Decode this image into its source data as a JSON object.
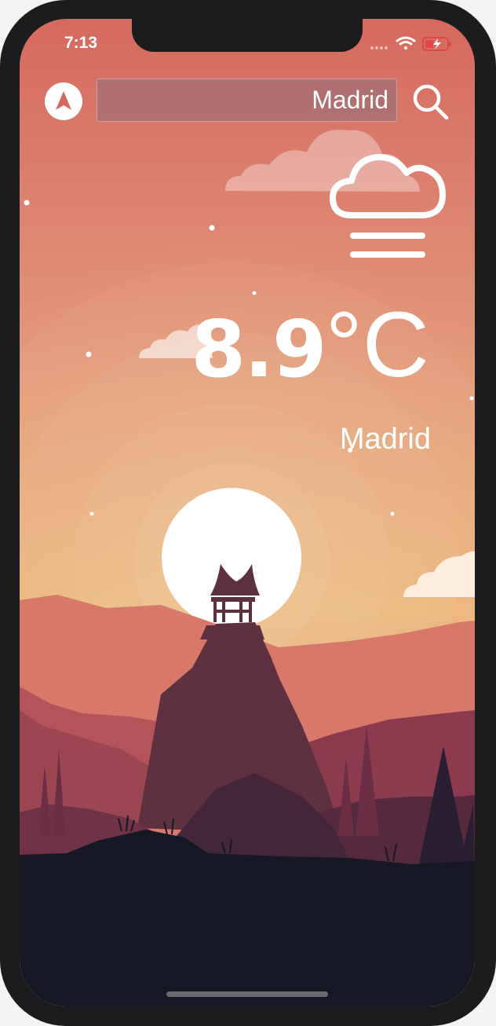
{
  "status_bar": {
    "time": "7:13",
    "icons": [
      "signal-dots-icon",
      "wifi-icon",
      "battery-charging-icon"
    ],
    "battery_color": "#e0474c"
  },
  "header": {
    "location_icon": "navigation-arrow-icon",
    "search": {
      "value": "Madrid",
      "placeholder": ""
    },
    "search_icon": "magnifier-icon"
  },
  "weather": {
    "condition_icon": "cloud-fog-icon",
    "temperature": "8.9",
    "unit": "°C",
    "city": "Madrid"
  },
  "theme": {
    "sky_top": "#d5695f",
    "sky_bottom": "#ebb57a",
    "sun": "#ffffff",
    "ground": "#161826"
  }
}
